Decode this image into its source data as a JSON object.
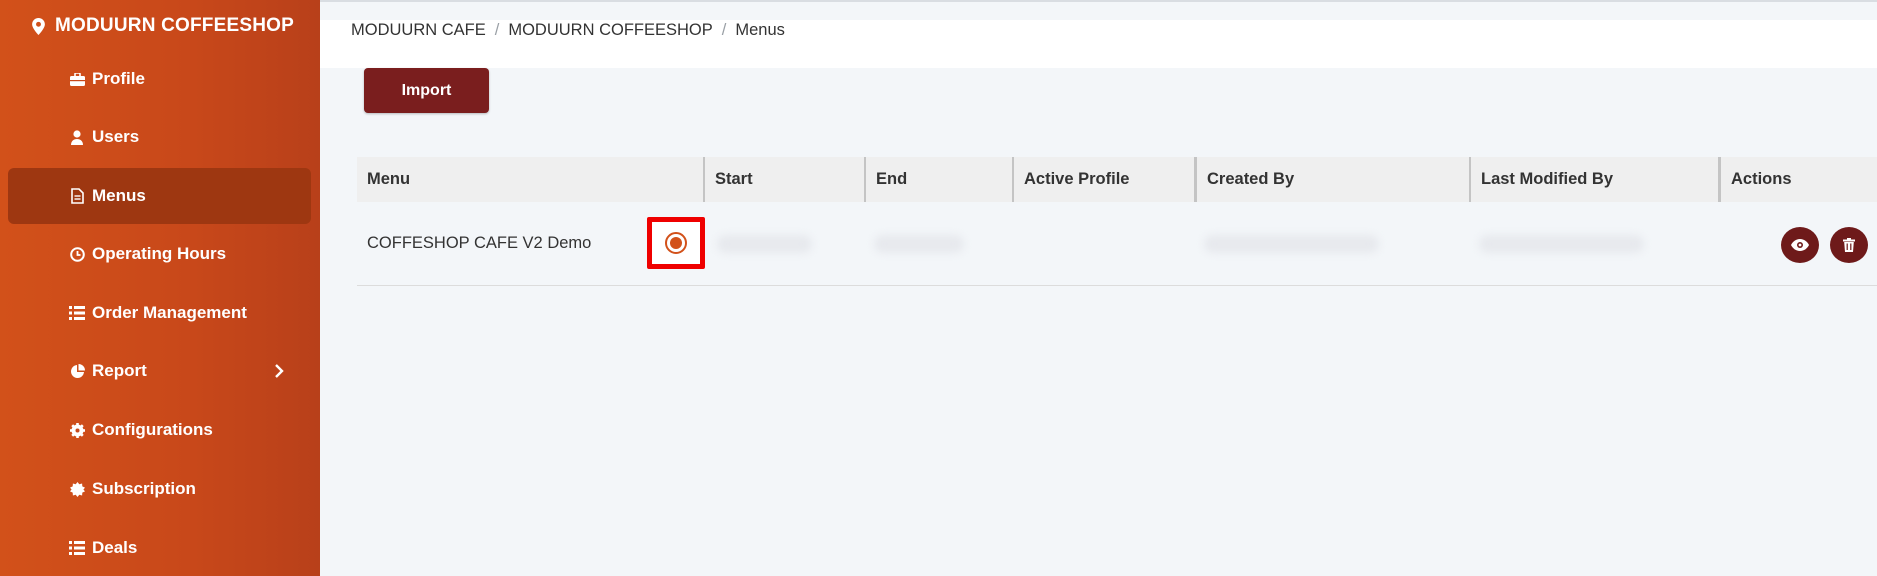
{
  "sidebar": {
    "brand": "MODUURN COFFEESHOP",
    "items": [
      {
        "label": "Profile",
        "icon": "briefcase-icon"
      },
      {
        "label": "Users",
        "icon": "user-icon"
      },
      {
        "label": "Menus",
        "icon": "document-icon",
        "active": true
      },
      {
        "label": "Operating Hours",
        "icon": "clock-icon"
      },
      {
        "label": "Order Management",
        "icon": "list-icon"
      },
      {
        "label": "Report",
        "icon": "pie-chart-icon",
        "has_submenu": true
      },
      {
        "label": "Configurations",
        "icon": "gear-icon"
      },
      {
        "label": "Subscription",
        "icon": "badge-icon"
      },
      {
        "label": "Deals",
        "icon": "list-icon"
      }
    ]
  },
  "breadcrumb": [
    "MODUURN CAFE",
    "MODUURN COFFEESHOP",
    "Menus"
  ],
  "toolbar": {
    "import_label": "Import"
  },
  "table": {
    "columns": [
      "Menu",
      "Start",
      "End",
      "Active Profile",
      "Created By",
      "Last Modified By",
      "Actions"
    ],
    "rows": [
      {
        "menu": "COFFESHOP CAFE V2 Demo",
        "start": "",
        "end": "",
        "active": true,
        "created_by": "",
        "last_modified_by": ""
      }
    ]
  },
  "colors": {
    "sidebar": "#c8481a",
    "active_item": "#9e3711",
    "button": "#7a1e1e",
    "highlight": "#ef0000"
  }
}
